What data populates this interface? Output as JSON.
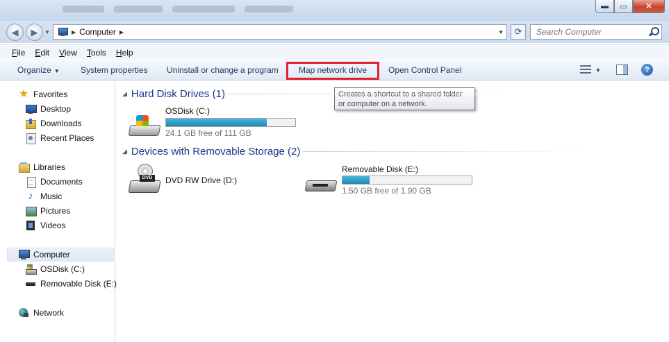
{
  "window": {
    "close_glyph": "✕",
    "minimize_glyph": "▬",
    "maximize_glyph": "▭"
  },
  "address": {
    "location": "Computer",
    "separator": "▶"
  },
  "search": {
    "placeholder": "Search Computer"
  },
  "menu": [
    {
      "letter": "F",
      "rest": "ile"
    },
    {
      "letter": "E",
      "rest": "dit"
    },
    {
      "letter": "V",
      "rest": "iew"
    },
    {
      "letter": "T",
      "rest": "ools"
    },
    {
      "letter": "H",
      "rest": "elp"
    }
  ],
  "commands": {
    "organize": "Organize",
    "system_properties": "System properties",
    "uninstall": "Uninstall or change a program",
    "map_drive": "Map network drive",
    "control_panel": "Open Control Panel",
    "help": "?"
  },
  "tooltip": {
    "line1": "Creates a shortcut to a shared folder",
    "line2": "or computer on a network."
  },
  "nav": {
    "favorites": "Favorites",
    "desktop": "Desktop",
    "downloads": "Downloads",
    "recent_places": "Recent Places",
    "libraries": "Libraries",
    "documents": "Documents",
    "music": "Music",
    "pictures": "Pictures",
    "videos": "Videos",
    "computer": "Computer",
    "osdisk": "OSDisk (C:)",
    "removable": "Removable Disk (E:)",
    "network": "Network"
  },
  "groups": {
    "hard_disk": "Hard Disk Drives (1)",
    "removable": "Devices with Removable Storage (2)"
  },
  "drives": {
    "osdisk": {
      "name": "OSDisk (C:)",
      "free": "24.1 GB free of 111 GB",
      "used_fraction": 0.78
    },
    "dvd": {
      "name": "DVD RW Drive (D:)",
      "badge": "DVD"
    },
    "removable": {
      "name": "Removable Disk (E:)",
      "free": "1.50 GB free of 1.90 GB",
      "used_fraction": 0.21
    }
  },
  "colors": {
    "highlight_box": "#e0202b",
    "group_header": "#1e3287",
    "bar_fill": "#1b88b3"
  }
}
